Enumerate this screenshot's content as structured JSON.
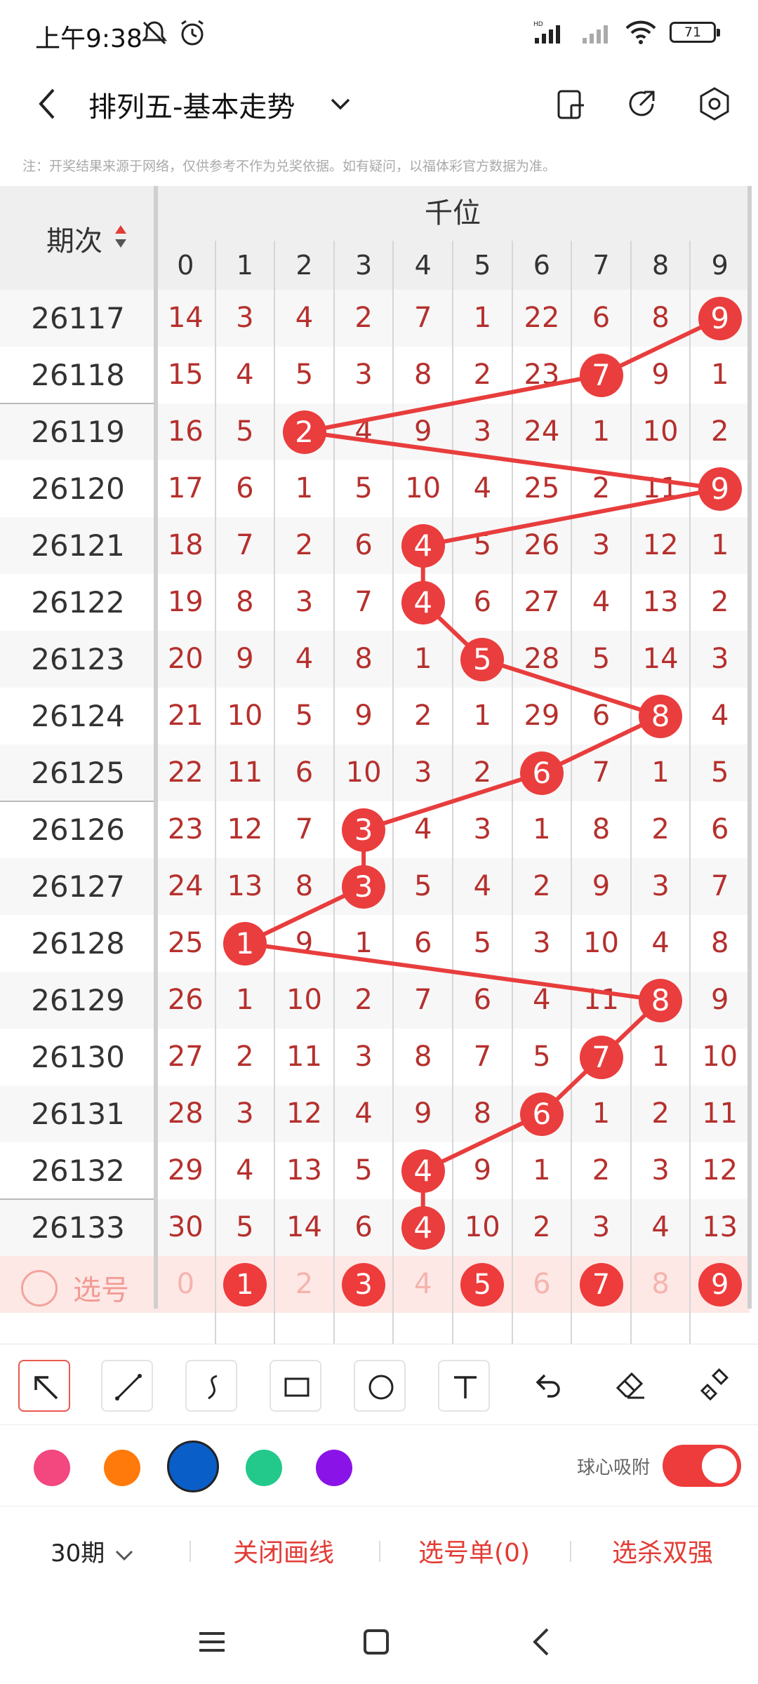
{
  "status_bar": {
    "time": "上午9:38",
    "battery": "71"
  },
  "header": {
    "title": "排列五-基本走势",
    "icons": [
      "back-arrow-icon",
      "chevron-down-icon",
      "display-icon",
      "share-icon",
      "settings-icon"
    ]
  },
  "notice": "注：开奖结果来源于网络，仅供参考不作为兑奖依据。如有疑问，以福体彩官方数据为准。",
  "table": {
    "issue_header": "期次",
    "group_header": "千位",
    "digits": [
      "0",
      "1",
      "2",
      "3",
      "4",
      "5",
      "6",
      "7",
      "8",
      "9"
    ],
    "rows": [
      {
        "issue": "26117",
        "hit": 9,
        "cells": [
          "14",
          "3",
          "4",
          "2",
          "7",
          "1",
          "22",
          "6",
          "8",
          "9"
        ]
      },
      {
        "issue": "26118",
        "hit": 7,
        "cells": [
          "15",
          "4",
          "5",
          "3",
          "8",
          "2",
          "23",
          "7",
          "9",
          "1"
        ]
      },
      {
        "issue": "26119",
        "hit": 2,
        "cells": [
          "16",
          "5",
          "2",
          "4",
          "9",
          "3",
          "24",
          "1",
          "10",
          "2"
        ]
      },
      {
        "issue": "26120",
        "hit": 9,
        "cells": [
          "17",
          "6",
          "1",
          "5",
          "10",
          "4",
          "25",
          "2",
          "11",
          "9"
        ]
      },
      {
        "issue": "26121",
        "hit": 4,
        "cells": [
          "18",
          "7",
          "2",
          "6",
          "4",
          "5",
          "26",
          "3",
          "12",
          "1"
        ]
      },
      {
        "issue": "26122",
        "hit": 4,
        "cells": [
          "19",
          "8",
          "3",
          "7",
          "4",
          "6",
          "27",
          "4",
          "13",
          "2"
        ]
      },
      {
        "issue": "26123",
        "hit": 5,
        "cells": [
          "20",
          "9",
          "4",
          "8",
          "1",
          "5",
          "28",
          "5",
          "14",
          "3"
        ]
      },
      {
        "issue": "26124",
        "hit": 8,
        "cells": [
          "21",
          "10",
          "5",
          "9",
          "2",
          "1",
          "29",
          "6",
          "8",
          "4"
        ]
      },
      {
        "issue": "26125",
        "hit": 6,
        "cells": [
          "22",
          "11",
          "6",
          "10",
          "3",
          "2",
          "6",
          "7",
          "1",
          "5"
        ]
      },
      {
        "issue": "26126",
        "hit": 3,
        "cells": [
          "23",
          "12",
          "7",
          "3",
          "4",
          "3",
          "1",
          "8",
          "2",
          "6"
        ]
      },
      {
        "issue": "26127",
        "hit": 3,
        "cells": [
          "24",
          "13",
          "8",
          "3",
          "5",
          "4",
          "2",
          "9",
          "3",
          "7"
        ]
      },
      {
        "issue": "26128",
        "hit": 1,
        "cells": [
          "25",
          "1",
          "9",
          "1",
          "6",
          "5",
          "3",
          "10",
          "4",
          "8"
        ]
      },
      {
        "issue": "26129",
        "hit": 8,
        "cells": [
          "26",
          "1",
          "10",
          "2",
          "7",
          "6",
          "4",
          "11",
          "8",
          "9"
        ]
      },
      {
        "issue": "26130",
        "hit": 7,
        "cells": [
          "27",
          "2",
          "11",
          "3",
          "8",
          "7",
          "5",
          "7",
          "1",
          "10"
        ]
      },
      {
        "issue": "26131",
        "hit": 6,
        "cells": [
          "28",
          "3",
          "12",
          "4",
          "9",
          "8",
          "6",
          "1",
          "2",
          "11"
        ]
      },
      {
        "issue": "26132",
        "hit": 4,
        "cells": [
          "29",
          "4",
          "13",
          "5",
          "4",
          "9",
          "1",
          "2",
          "3",
          "12"
        ]
      },
      {
        "issue": "26133",
        "hit": 4,
        "cells": [
          "30",
          "5",
          "14",
          "6",
          "4",
          "10",
          "2",
          "3",
          "4",
          "13"
        ]
      }
    ],
    "pick_row": {
      "label": "选号",
      "selected": [
        "1",
        "3",
        "5",
        "7",
        "9"
      ]
    }
  },
  "toolbar": {
    "tools": [
      "pointer-tool",
      "line-tool",
      "curve-tool",
      "rectangle-tool",
      "circle-tool",
      "text-tool",
      "undo-tool",
      "eraser-tool",
      "clear-tool"
    ],
    "colors": [
      "#f2477f",
      "#ff7a0a",
      "#0a5ec8",
      "#22c98a",
      "#8a14e8"
    ],
    "selected_color": "#0a5ec8",
    "snap_label": "球心吸附",
    "snap_enabled": true
  },
  "bottom": {
    "period": "30期",
    "actions": [
      "关闭画线",
      "选号单(0)",
      "选杀双强"
    ]
  }
}
